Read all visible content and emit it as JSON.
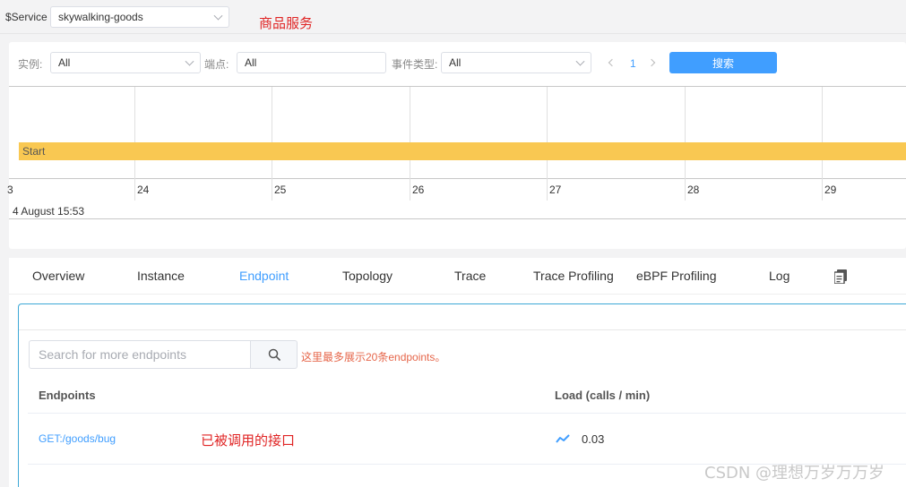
{
  "header": {
    "service_label": "$Service",
    "service_value": "skywalking-goods",
    "annotation": "商品服务"
  },
  "filters": {
    "instance_label": "实例:",
    "instance_value": "All",
    "endpoint_label": "端点:",
    "endpoint_value": "All",
    "event_type_label": "事件类型:",
    "event_type_value": "All",
    "page": "1",
    "search_button": "搜索"
  },
  "timeline": {
    "bar_label": "Start",
    "ticks": [
      "3",
      "24",
      "25",
      "26",
      "27",
      "28",
      "29"
    ],
    "date_label": "4 August 15:53"
  },
  "tabs": [
    {
      "label": "Overview"
    },
    {
      "label": "Instance"
    },
    {
      "label": "Endpoint"
    },
    {
      "label": "Topology"
    },
    {
      "label": "Trace"
    },
    {
      "label": "Trace Profiling"
    },
    {
      "label": "eBPF Profiling"
    },
    {
      "label": "Log"
    }
  ],
  "active_tab": "Endpoint",
  "endpoints": {
    "search_placeholder": "Search for more endpoints",
    "hint": "这里最多展示20条endpoints。",
    "col_endpoints": "Endpoints",
    "col_load": "Load (calls / min)",
    "rows": [
      {
        "name": "GET:/goods/bug",
        "load": "0.03"
      }
    ],
    "annotation": "已被调用的接口"
  },
  "colors": {
    "accent": "#409eff",
    "bar": "#f9c852",
    "annotation": "#e02424"
  },
  "watermark": "CSDN @理想万岁万万岁"
}
